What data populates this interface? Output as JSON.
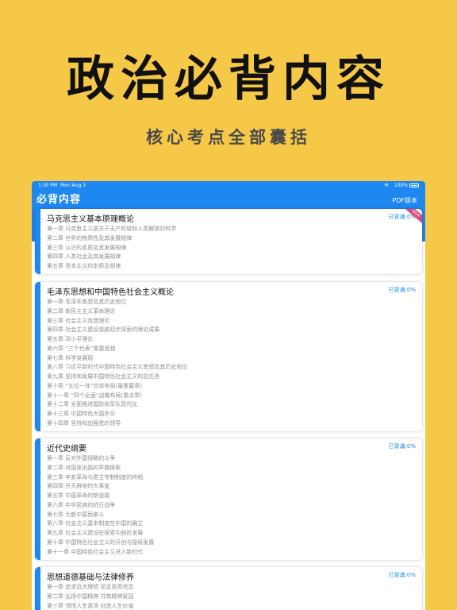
{
  "promo": {
    "headline": "政治必背内容",
    "subline": "核心考点全部囊括"
  },
  "statusbar": {
    "time": "1:30 PM",
    "date": "Mon Aug 3",
    "battery": "100%"
  },
  "navbar": {
    "title": "必背内容",
    "pdf_label": "PDF版本"
  },
  "badge": {
    "label": "NEW"
  },
  "cards": [
    {
      "title": "马克思主义基本原理概论",
      "progress": "已背诵:0%",
      "chapters": [
        "第一章 马克思主义是关于无产阶级和人类解放的科学",
        "第二章 世界的物质性及其发展规律",
        "第三章 认识的本质及其发展规律",
        "第四章 人类社会及其发展规律",
        "第五章 资本主义的本质及规律"
      ]
    },
    {
      "title": "毛泽东思想和中国特色社会主义概论",
      "progress": "已背诵:0%",
      "chapters": [
        "第一章 毛泽东思想及其历史地位",
        "第二章 新民主主义革命理论",
        "第三章 社会主义改造理论",
        "第四章 社会主义建设道路初步探索的理论成果",
        "第五章 邓小平理论",
        "第六章 “三个代表”重要思想",
        "第七章 科学发展观",
        "第八章 习近平新时代中国特色社会主义思想及其历史地位",
        "第九章 坚持和发展中国特色社会主义的总任务",
        "第十章 “五位一体”总体布局(最重要章)",
        "第十一章 “四个全面”战略布局(重点章)",
        "第十二章 全面推进国防和军队现代化",
        "第十三章 中国特色大国外交",
        "第十四章 坚持和加强党的领导"
      ]
    },
    {
      "title": "近代史纲要",
      "progress": "已背诵:0%",
      "chapters": [
        "第一章 反对外国侵略的斗争",
        "第二章 对国家出路的早期探索",
        "第三章 辛亥革命与君主专制制度的终结",
        "第四章 开天辟地的大事变",
        "第五章 中国革命的新道路",
        "第六章 中华民族的抗日战争",
        "第七章 为新中国而奋斗",
        "第八章 社会主义基本制度在中国的确立",
        "第九章 社会主义建设在探索中曲折发展",
        "第十章 中国特色社会主义的开创与接续发展",
        "第十一章 中国特色社会主义进入新时代"
      ]
    },
    {
      "title": "思想道德基础与法律修养",
      "progress": "已背诵:0%",
      "chapters": [
        "第一章 追求远大理想 坚定崇高信念",
        "第二章 弘扬中国精神 共筑精神家园",
        "第三章 领悟人生真谛 创造人生价值"
      ]
    }
  ]
}
